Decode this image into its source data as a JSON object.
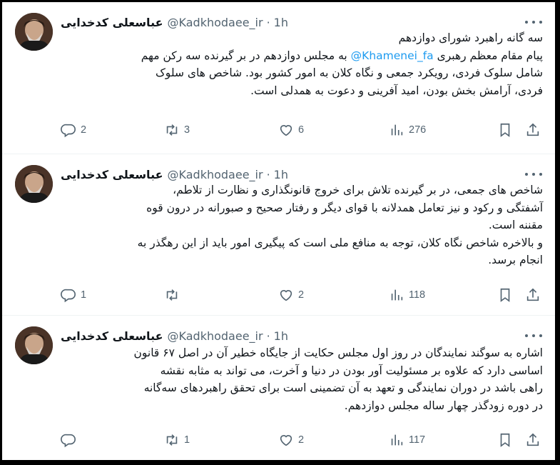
{
  "tweets": [
    {
      "author": "عباسعلی کدخدایی",
      "handle": "@Kadkhodaee_ir",
      "separator": "·",
      "time": "1h",
      "lines": [
        "سه گانه راهبرد شورای دوازدهم",
        "",
        "شامل سلوک فردی، رویکرد جمعی و نگاه کلان به امور کشور بود. شاخص های سلوک",
        "فردی، آرامش بخش بودن، امید آفرینی و دعوت به همدلی است."
      ],
      "line2_pre": "پیام مقام معظم رهبری",
      "line2_mention": "@Khamenei_fa",
      "line2_post": "به مجلس دوازدهم در بر گیرنده سه رکن مهم",
      "replies": "2",
      "retweets": "3",
      "likes": "6",
      "views": "276"
    },
    {
      "author": "عباسعلی کدخدایی",
      "handle": "@Kadkhodaee_ir",
      "separator": "·",
      "time": "1h",
      "lines": [
        "شاخص های جمعی، در بر گیرنده تلاش برای خروج قانونگذاری و نظارت از تلاطم،",
        "آشفتگی و رکود و نیز تعامل همدلانه با قوای دیگر و رفتار صحیح و صبورانه در درون قوه",
        "مقننه است.",
        "و بالاخره شاخص نگاه کلان، توجه به منافع ملی است که پیگیری امور باید از این رهگذر به",
        "انجام برسد."
      ],
      "replies": "1",
      "retweets": "",
      "likes": "2",
      "views": "118"
    },
    {
      "author": "عباسعلی کدخدایی",
      "handle": "@Kadkhodaee_ir",
      "separator": "·",
      "time": "1h",
      "lines": [
        "اشاره به سوگند نمایندگان در روز اول مجلس حکایت از جایگاه خطیر آن در اصل ۶۷ قانون",
        "اساسی دارد که علاوه بر مسئولیت آور بودن در دنیا و آخرت، می تواند به مثابه نقشه",
        "راهی باشد در دوران نمایندگی و تعهد به آن تضمینی است برای تحقق راهبردهای سه‌گانه",
        "در دوره زودگذر چهار ساله مجلس دوازدهم."
      ],
      "replies": "",
      "retweets": "1",
      "likes": "2",
      "views": "117"
    }
  ],
  "icons": {
    "reply": "reply-icon",
    "retweet": "retweet-icon",
    "like": "heart-icon",
    "views": "views-icon",
    "bookmark": "bookmark-icon",
    "share": "share-icon",
    "more": "more-icon"
  },
  "colors": {
    "text": "#0f1419",
    "muted": "#536471",
    "link": "#1d9bf0"
  }
}
